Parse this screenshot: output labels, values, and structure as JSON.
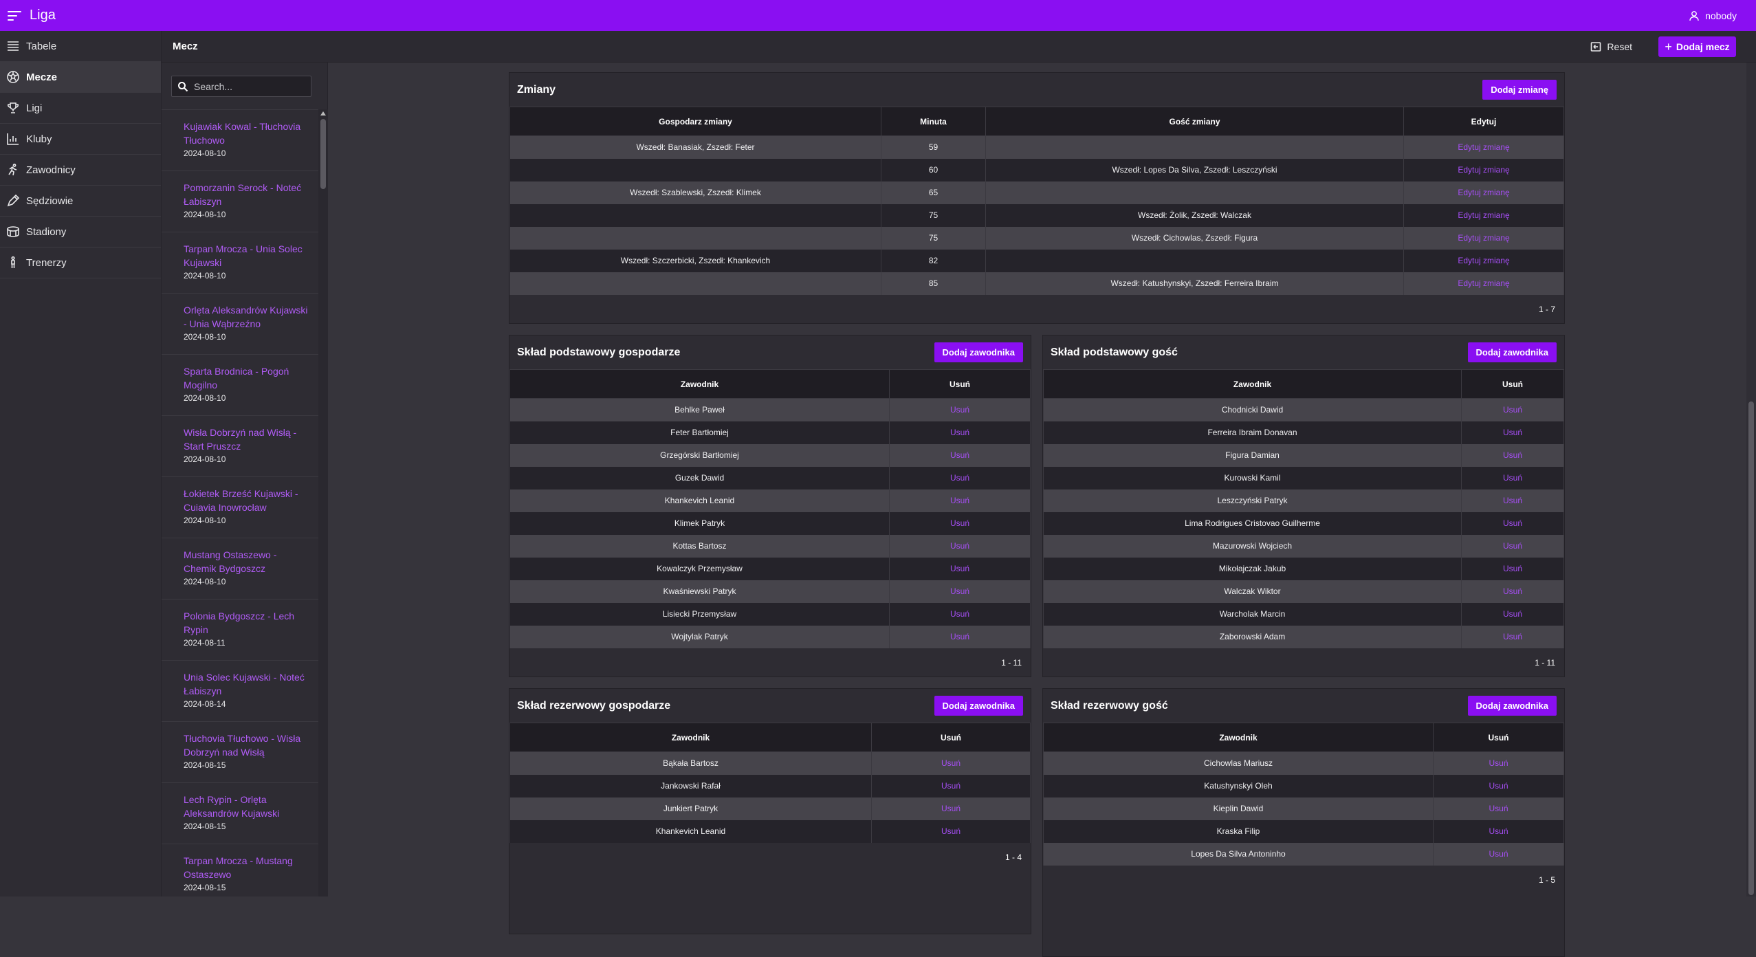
{
  "app": {
    "title": "Liga",
    "user": "nobody"
  },
  "sidebar": {
    "items": [
      {
        "label": "Tabele",
        "icon": "table-icon"
      },
      {
        "label": "Mecze",
        "icon": "soccer-ball-icon",
        "active": true
      },
      {
        "label": "Ligi",
        "icon": "trophy-icon"
      },
      {
        "label": "Kluby",
        "icon": "chart-icon"
      },
      {
        "label": "Zawodnicy",
        "icon": "runner-icon"
      },
      {
        "label": "Sędziowie",
        "icon": "whistle-pen-icon"
      },
      {
        "label": "Stadiony",
        "icon": "stadium-icon"
      },
      {
        "label": "Trenerzy",
        "icon": "coach-icon"
      }
    ]
  },
  "header": {
    "title": "Mecz",
    "reset_label": "Reset",
    "add_label": "Dodaj mecz"
  },
  "search": {
    "placeholder": "Search..."
  },
  "matches": [
    {
      "name": "Kujawiak Kowal - Tłuchovia Tłuchowo",
      "date": "2024-08-10"
    },
    {
      "name": "Pomorzanin Serock - Noteć Łabiszyn",
      "date": "2024-08-10"
    },
    {
      "name": "Tarpan Mrocza - Unia Solec Kujawski",
      "date": "2024-08-10"
    },
    {
      "name": "Orlęta Aleksandrów Kujawski - Unia Wąbrzeźno",
      "date": "2024-08-10"
    },
    {
      "name": "Sparta Brodnica - Pogoń Mogilno",
      "date": "2024-08-10"
    },
    {
      "name": "Wisła Dobrzyń nad Wisłą - Start Pruszcz",
      "date": "2024-08-10"
    },
    {
      "name": "Łokietek Brześć Kujawski - Cuiavia Inowrocław",
      "date": "2024-08-10"
    },
    {
      "name": "Mustang Ostaszewo - Chemik Bydgoszcz",
      "date": "2024-08-10"
    },
    {
      "name": "Polonia Bydgoszcz - Lech Rypin",
      "date": "2024-08-11"
    },
    {
      "name": "Unia Solec Kujawski - Noteć Łabiszyn",
      "date": "2024-08-14"
    },
    {
      "name": "Tłuchovia Tłuchowo - Wisła Dobrzyń nad Wisłą",
      "date": "2024-08-15"
    },
    {
      "name": "Lech Rypin - Orlęta Aleksandrów Kujawski",
      "date": "2024-08-15"
    },
    {
      "name": "Tarpan Mrocza - Mustang Ostaszewo",
      "date": "2024-08-15"
    }
  ],
  "substitutions": {
    "title": "Zmiany",
    "button": "Dodaj zmianę",
    "columns": [
      "Gospodarz zmiany",
      "Minuta",
      "Gość zmiany",
      "Edytuj"
    ],
    "link_label": "Edytuj zmianę",
    "rows": [
      {
        "home": "Wszedł: Banasiak, Zszedł: Feter",
        "minute": "59",
        "away": ""
      },
      {
        "home": "",
        "minute": "60",
        "away": "Wszedł: Lopes Da Silva, Zszedł: Leszczyński"
      },
      {
        "home": "Wszedł: Szablewski, Zszedł: Klimek",
        "minute": "65",
        "away": ""
      },
      {
        "home": "",
        "minute": "75",
        "away": "Wszedł: Żolik, Zszedł: Walczak"
      },
      {
        "home": "",
        "minute": "75",
        "away": "Wszedł: Cichowlas, Zszedł: Figura"
      },
      {
        "home": "Wszedł: Szczerbicki, Zszedł: Khankevich",
        "minute": "82",
        "away": ""
      },
      {
        "home": "",
        "minute": "85",
        "away": "Wszedł: Katushynskyi, Zszedł: Ferreira Ibraim"
      }
    ],
    "footer": "1 - 7"
  },
  "lineups": [
    {
      "title": "Skład podstawowy gospodarze",
      "button": "Dodaj zawodnika",
      "columns": [
        "Zawodnik",
        "Usuń"
      ],
      "link_label": "Usuń",
      "players": [
        "Behlke Paweł",
        "Feter Bartłomiej",
        "Grzegórski Bartłomiej",
        "Guzek Dawid",
        "Khankevich Leanid",
        "Klimek Patryk",
        "Kottas Bartosz",
        "Kowalczyk Przemysław",
        "Kwaśniewski Patryk",
        "Lisiecki Przemysław",
        "Wojtylak Patryk"
      ],
      "footer": "1 - 11"
    },
    {
      "title": "Skład podstawowy gość",
      "button": "Dodaj zawodnika",
      "columns": [
        "Zawodnik",
        "Usuń"
      ],
      "link_label": "Usuń",
      "players": [
        "Chodnicki Dawid",
        "Ferreira Ibraim Donavan",
        "Figura Damian",
        "Kurowski Kamil",
        "Leszczyński Patryk",
        "Lima Rodrigues Cristovao Guilherme",
        "Mazurowski Wojciech",
        "Mikołajczak Jakub",
        "Walczak Wiktor",
        "Warcholak Marcin",
        "Zaborowski Adam"
      ],
      "footer": "1 - 11"
    },
    {
      "title": "Skład rezerwowy gospodarze",
      "button": "Dodaj zawodnika",
      "columns": [
        "Zawodnik",
        "Usuń"
      ],
      "link_label": "Usuń",
      "players": [
        "Bąkała Bartosz",
        "Jankowski Rafał",
        "Junkiert Patryk",
        "Khankevich Leanid"
      ],
      "footer": "1 - 4"
    },
    {
      "title": "Skład rezerwowy gość",
      "button": "Dodaj zawodnika",
      "columns": [
        "Zawodnik",
        "Usuń"
      ],
      "link_label": "Usuń",
      "players": [
        "Cichowlas Mariusz",
        "Katushynskyi Oleh",
        "Kieplin Dawid",
        "Kraska Filip",
        "Lopes Da Silva Antoninho"
      ],
      "footer": "1 - 5"
    }
  ],
  "colors": {
    "accent": "#8a0ff2",
    "link": "#a64ef5",
    "background": "#36343b"
  }
}
